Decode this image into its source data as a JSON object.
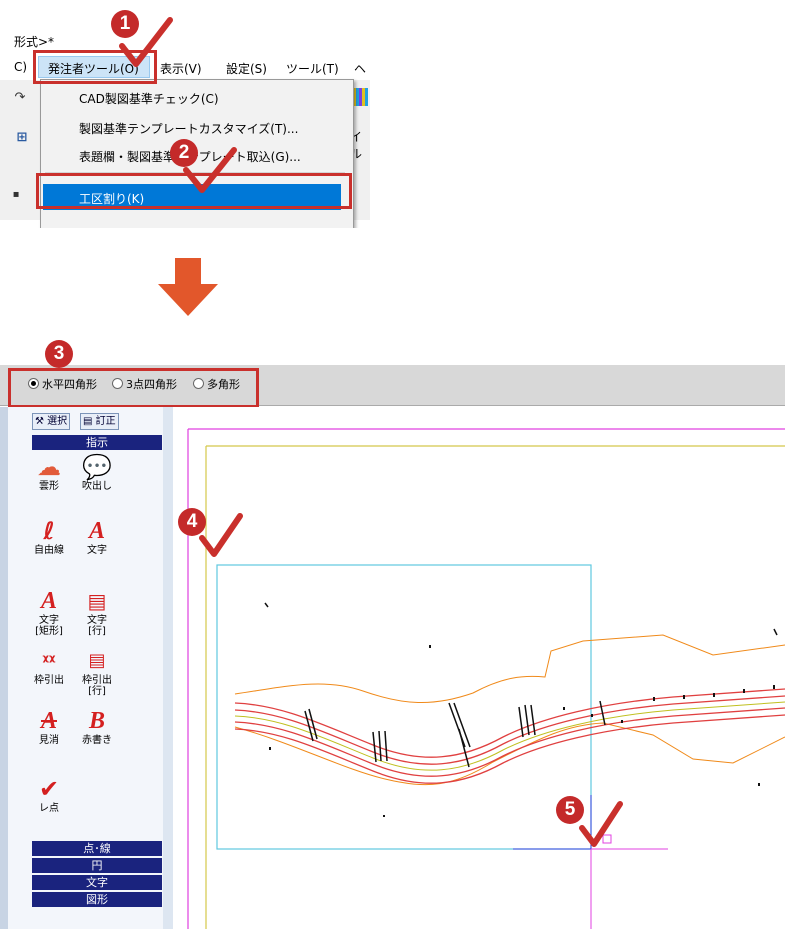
{
  "top_screenshot": {
    "title_fragment": "形式>*",
    "menubar": {
      "left_cut": "C)",
      "open_menu": "発注者ツール(O)",
      "items": [
        "表示(V)",
        "設定(S)",
        "ツール(T)",
        "ヘ"
      ]
    },
    "toolbar_fragment": "イル",
    "dropdown": {
      "items": [
        "CAD製図基準チェック(C)",
        "製図基準テンプレートカスタマイズ(T)...",
        "表題欄・製図基準テンプレート取込(G)..."
      ],
      "highlighted_item": "工区割り(K)"
    }
  },
  "steps": [
    "1",
    "2",
    "3",
    "4",
    "5"
  ],
  "bottom_screenshot": {
    "mode_options": [
      {
        "label": "水平四角形",
        "selected": true
      },
      {
        "label": "3点四角形",
        "selected": false
      },
      {
        "label": "多角形",
        "selected": false
      }
    ],
    "panel_buttons": [
      "選択",
      "訂正"
    ],
    "sections": {
      "shiji": "指示",
      "tensen": "点･線",
      "en": "円",
      "moji": "文字",
      "zukei": "図形"
    },
    "tools": {
      "kumogata": "雲形",
      "fukidashi": "吹出し",
      "jiyusen": "自由線",
      "moji": "文字",
      "moji_kukei": "文字\n[矩形]",
      "moji_gyo": "文字\n[行]",
      "wakubikidashi": "枠引出",
      "wakubikidashi_gyo": "枠引出\n[行]",
      "mikeshi": "見消",
      "akagaki": "赤書き",
      "reten": "レ点"
    }
  },
  "colors": {
    "accent_red": "#c9302c",
    "highlight_blue": "#0078d7",
    "arrow_orange": "#e2572b",
    "panel_header_navy": "#1a237e",
    "frame_magenta": "#e040e0",
    "frame_yellow": "#d4c84a",
    "selection_cyan": "#5fc8e0"
  }
}
